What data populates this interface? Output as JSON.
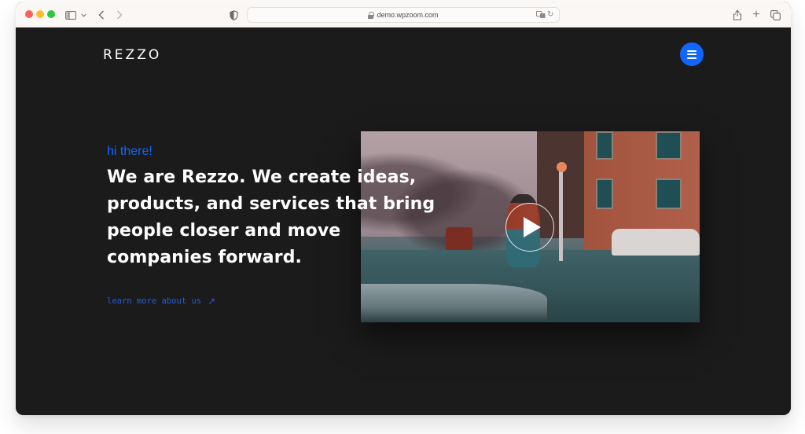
{
  "browser": {
    "url": "demo.wpzoom.com",
    "icons": {
      "close": "close-window",
      "minimize": "minimize-window",
      "zoom": "zoom-window",
      "sidebar": "sidebar-icon",
      "back": "‹",
      "forward": "›",
      "privacy": "shield-icon",
      "translate": "translate-icon",
      "reload": "↻",
      "share": "share-icon",
      "new_tab": "+",
      "tabs": "tabs-overview-icon"
    }
  },
  "site": {
    "logo": "REZZO",
    "menu_icon": "hamburger-menu-icon",
    "accent_color": "#1166ff",
    "background_color": "#1b1b1b"
  },
  "hero": {
    "greeting": "hi there!",
    "headline": "We are Rezzo. We create ideas, products, and services that bring people closer and move companies forward.",
    "cta_label": "learn more about us",
    "cta_arrow": "↗",
    "video": {
      "description": "Person running across a wet city street with brick buildings and parked cars",
      "play_icon": "play-icon"
    }
  }
}
